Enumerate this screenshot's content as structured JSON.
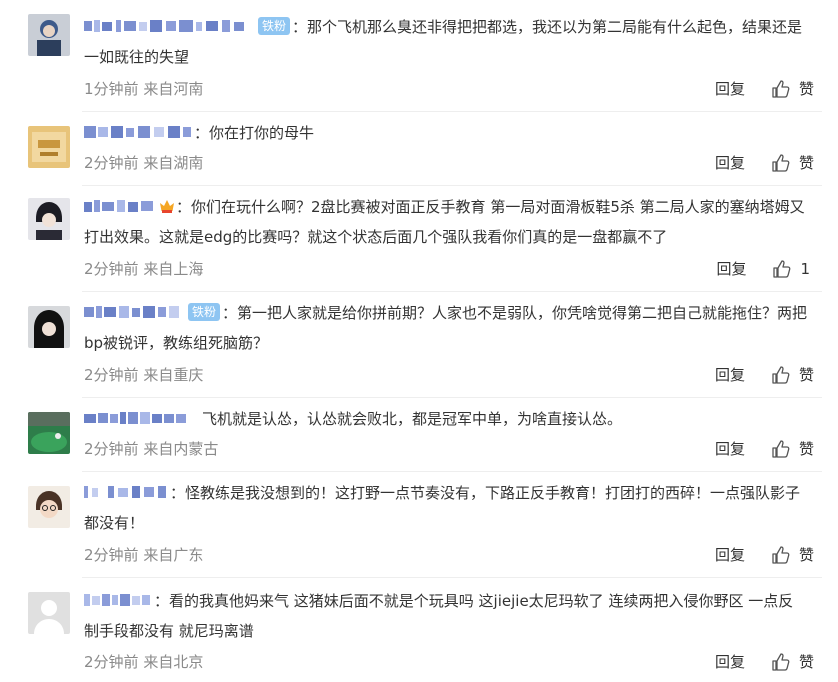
{
  "comments": [
    {
      "badge": "铁粉",
      "sep": "：",
      "text": "那个飞机那么臭还非得把把都选，我还以为第二局能有什么起色，结果还是一如既往的失望",
      "time": "1分钟前",
      "location": "来自河南",
      "reply": "回复",
      "like": "赞"
    },
    {
      "badge": "",
      "sep": "：",
      "text": "你在打你的母牛",
      "time": "2分钟前",
      "location": "来自湖南",
      "reply": "回复",
      "like": "赞"
    },
    {
      "badge": "",
      "sep": "：",
      "text": "你们在玩什么啊？2盘比赛被对面正反手教育 第一局对面滑板鞋5杀 第二局人家的塞纳塔姆又打出效果。这就是edg的比赛吗？就这个状态后面几个强队我看你们真的是一盘都赢不了",
      "time": "2分钟前",
      "location": "来自上海",
      "reply": "回复",
      "like": "1"
    },
    {
      "badge": "铁粉",
      "sep": "：",
      "text": "第一把人家就是给你拼前期？人家也不是弱队，你凭啥觉得第二把自己就能拖住？两把bp被锐评，教练组死脑筋？",
      "time": "2分钟前",
      "location": "来自重庆",
      "reply": "回复",
      "like": "赞"
    },
    {
      "badge": "",
      "sep": "：",
      "text": "飞机就是认怂，认怂就会败北，都是冠军中单，为啥直接认怂。",
      "time": "2分钟前",
      "location": "来自内蒙古",
      "reply": "回复",
      "like": "赞"
    },
    {
      "badge": "",
      "sep": "：",
      "text": "怪教练是我没想到的！这打野一点节奏没有，下路正反手教育！打团打的西碎！一点强队影子都没有！",
      "time": "2分钟前",
      "location": "来自广东",
      "reply": "回复",
      "like": "赞"
    },
    {
      "badge": "",
      "sep": "：",
      "text": "看的我真他妈来气 这猪妹后面不就是个玩具吗 这jiejie太尼玛软了 连续两把入侵你野区 一点反制手段都没有 就尼玛离谱",
      "time": "2分钟前",
      "location": "来自北京",
      "reply": "回复",
      "like": "赞"
    }
  ],
  "colors": {
    "text": "#333333",
    "meta": "#8a8a8a",
    "badge_bg": "#8ec5f2",
    "divider": "#eeeeee"
  },
  "icons": {
    "like": "thumbs-up-icon",
    "vip": "vip-crown-icon"
  }
}
